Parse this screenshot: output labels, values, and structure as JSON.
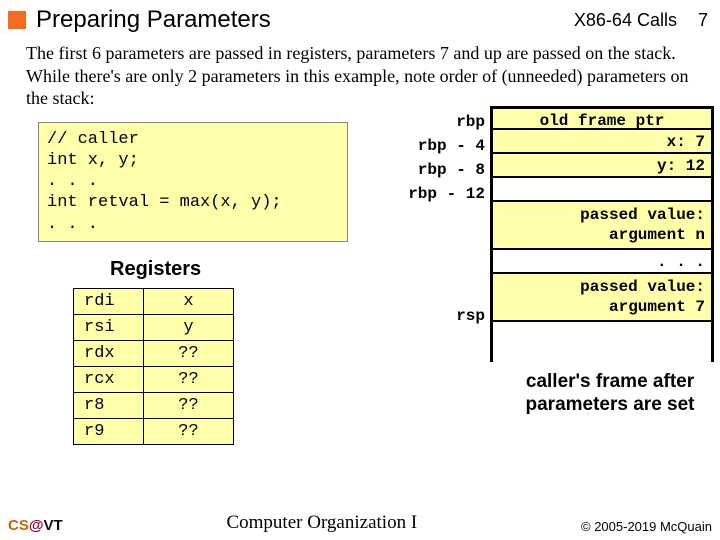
{
  "header": {
    "title": "Preparing Parameters",
    "section": "X86-64 Calls",
    "page": "7"
  },
  "paragraph": "The first 6 parameters are passed in registers, parameters 7 and up are passed on the stack. While there's are only 2 parameters in this example, note order of (unneeded) parameters on the stack:",
  "code": {
    "l1": "// caller",
    "l2": "int x, y;",
    "l3": ". . .",
    "l4": "int retval = max(x, y);",
    "l5": ". . ."
  },
  "registers": {
    "heading": "Registers",
    "rows": [
      {
        "r": "rdi",
        "v": "x"
      },
      {
        "r": "rsi",
        "v": "y"
      },
      {
        "r": "rdx",
        "v": "??"
      },
      {
        "r": "rcx",
        "v": "??"
      },
      {
        "r": "r8",
        "v": "??"
      },
      {
        "r": "r9",
        "v": "??"
      }
    ]
  },
  "stack": {
    "labels": {
      "l0": "rbp",
      "l1": "rbp -  4",
      "l2": "rbp -  8",
      "l3": "rbp - 12",
      "rsp": "rsp"
    },
    "rows": {
      "r0": "old frame ptr",
      "r1": "x:  7",
      "r2": "y: 12",
      "r3": "",
      "r4a": "passed value:",
      "r4b": "argument n",
      "r5": ". . .",
      "r6a": "passed value:",
      "r6b": "argument 7"
    }
  },
  "caption": "caller's frame after parameters are set",
  "footer": {
    "left_cs": "CS",
    "left_at": "@",
    "left_vt": "VT",
    "mid": "Computer Organization I",
    "right": "© 2005-2019 McQuain"
  }
}
